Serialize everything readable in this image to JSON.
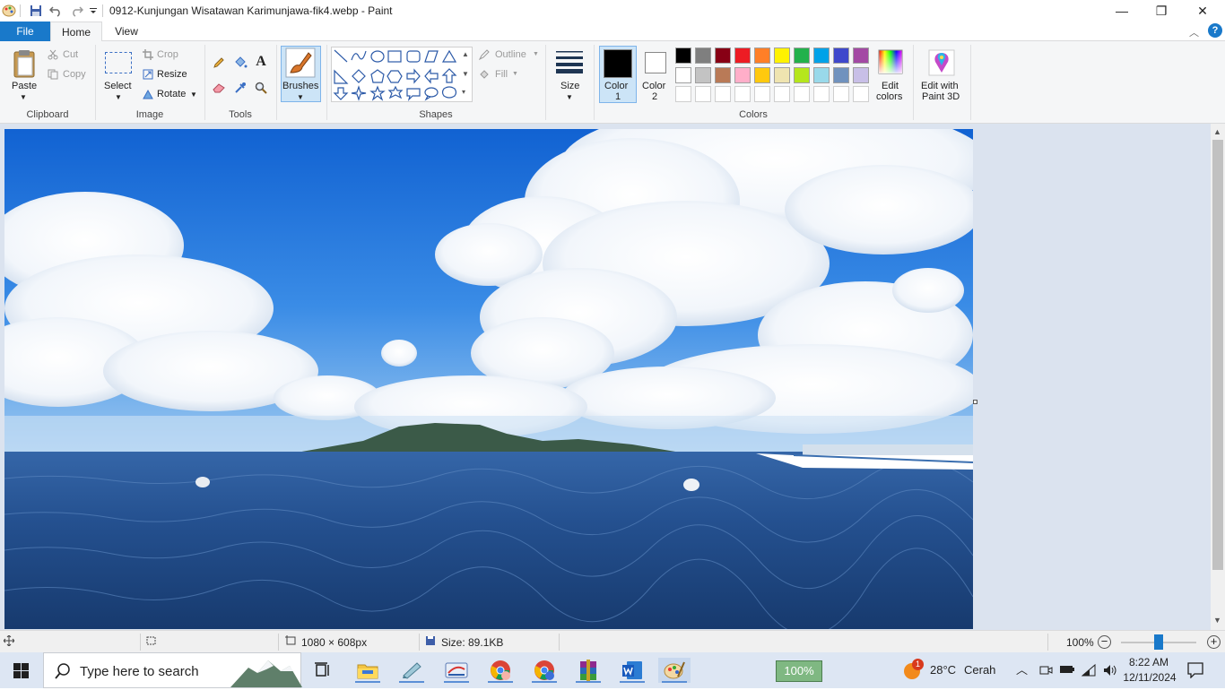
{
  "window": {
    "title": "0912-Kunjungan Wisatawan Karimunjawa-fik4.webp - Paint",
    "minimize": "—",
    "restore": "❐",
    "close": "✕"
  },
  "menu": {
    "file": "File",
    "home": "Home",
    "view": "View",
    "help": "?"
  },
  "ribbon": {
    "clipboard": {
      "label": "Clipboard",
      "paste": "Paste",
      "cut": "Cut",
      "copy": "Copy"
    },
    "image": {
      "label": "Image",
      "select": "Select",
      "crop": "Crop",
      "resize": "Resize",
      "rotate": "Rotate"
    },
    "tools": {
      "label": "Tools"
    },
    "brushes": {
      "label": "Brushes"
    },
    "shapes": {
      "label": "Shapes",
      "outline": "Outline",
      "fill": "Fill"
    },
    "size": {
      "label": "Size"
    },
    "colors": {
      "label": "Colors",
      "color1_line1": "Color",
      "color1_line2": "1",
      "color2_line1": "Color",
      "color2_line2": "2",
      "edit_line1": "Edit",
      "edit_line2": "colors",
      "paint3d_line1": "Edit with",
      "paint3d_line2": "Paint 3D",
      "color1_value": "#000000",
      "color2_value": "#ffffff",
      "palette_row1": [
        "#000000",
        "#7f7f7f",
        "#880015",
        "#ed1c24",
        "#ff7f27",
        "#fff200",
        "#22b14c",
        "#00a2e8",
        "#3f48cc",
        "#a349a4"
      ],
      "palette_row2": [
        "#ffffff",
        "#c3c3c3",
        "#b97a57",
        "#ffaec9",
        "#ffc90e",
        "#efe4b0",
        "#b5e61d",
        "#99d9ea",
        "#7092be",
        "#c8bfe7"
      ]
    }
  },
  "statusbar": {
    "dimensions": "1080 × 608px",
    "size": "Size: 89.1KB",
    "zoom": "100%"
  },
  "taskbar": {
    "search_placeholder": "Type here to search",
    "battery_badge": "100%",
    "weather_temp": "28°C",
    "weather_text": "Cerah",
    "weather_alert": "1",
    "time": "8:22 AM",
    "date": "12/11/2024"
  }
}
